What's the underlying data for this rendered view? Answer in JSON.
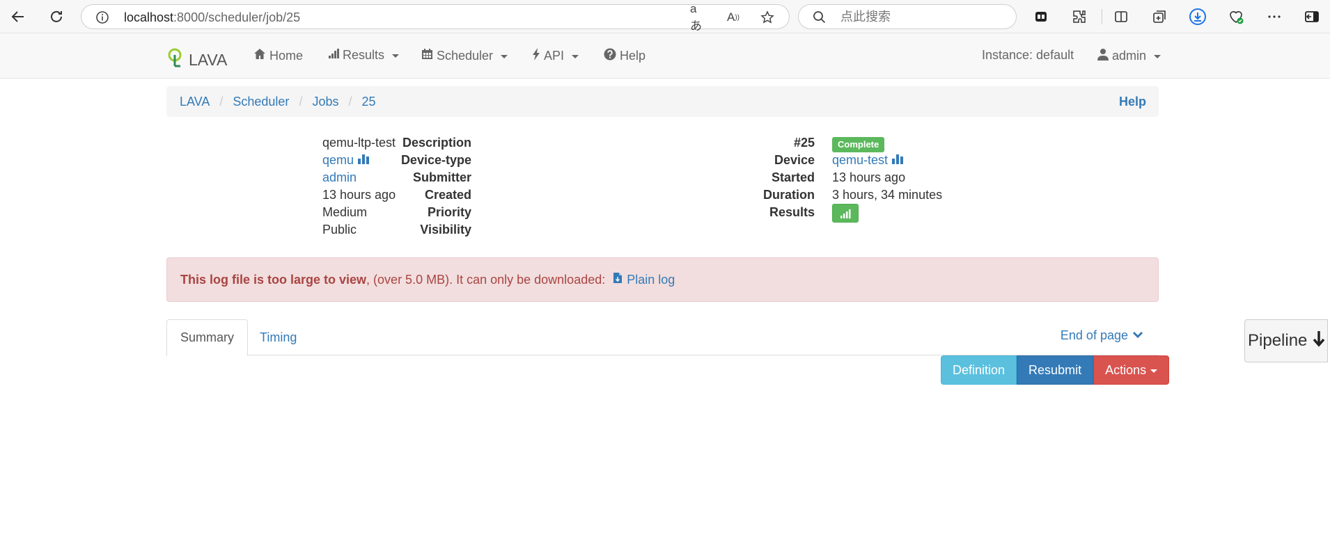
{
  "browser": {
    "url_host": "localhost",
    "url_path": ":8000/scheduler/job/25",
    "search_placeholder": "点此搜索"
  },
  "navbar": {
    "brand": "LAVA",
    "items": [
      {
        "label": "Home",
        "icon": "home-icon"
      },
      {
        "label": "Results",
        "icon": "bar-chart-icon",
        "dropdown": true
      },
      {
        "label": "Scheduler",
        "icon": "calendar-icon",
        "dropdown": true
      },
      {
        "label": "API",
        "icon": "bolt-icon",
        "dropdown": true
      },
      {
        "label": "Help",
        "icon": "question-circle-icon"
      }
    ],
    "instance": "Instance: default",
    "user": "admin"
  },
  "breadcrumb": {
    "items": [
      "LAVA",
      "Scheduler",
      "Jobs",
      "25"
    ],
    "help": "Help"
  },
  "job_left": {
    "description_label": "Description",
    "description": "qemu-ltp-test",
    "device_type_label": "Device-type",
    "device_type": "qemu",
    "submitter_label": "Submitter",
    "submitter": "admin",
    "created_label": "Created",
    "created": "13 hours ago",
    "priority_label": "Priority",
    "priority": "Medium",
    "visibility_label": "Visibility",
    "visibility": "Public"
  },
  "job_right": {
    "id": "#25",
    "status": "Complete",
    "device_label": "Device",
    "device": "qemu-test",
    "started_label": "Started",
    "started": "13 hours ago",
    "duration_label": "Duration",
    "duration": "3 hours, 34 minutes",
    "results_label": "Results"
  },
  "alert": {
    "bold": "This log file is too large to view",
    "text": ", (over 5.0 MB). It can only be downloaded: ",
    "link": "Plain log"
  },
  "tabs": {
    "summary": "Summary",
    "timing": "Timing",
    "end_of_page": "End of page"
  },
  "buttons": {
    "definition": "Definition",
    "resubmit": "Resubmit",
    "actions": "Actions"
  },
  "pipeline": "Pipeline",
  "colors": {
    "link": "#337ab7",
    "success": "#5cb85c",
    "danger": "#d9534f",
    "info": "#5bc0de",
    "alert_bg": "#f2dede"
  }
}
